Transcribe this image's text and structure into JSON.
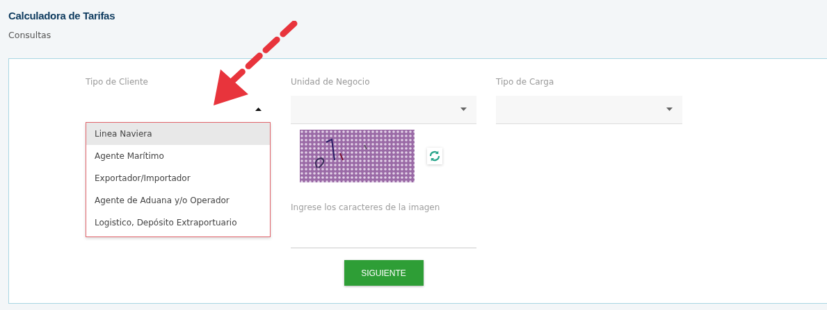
{
  "header": {
    "title": "Calculadora de Tarifas",
    "subtitle": "Consultas"
  },
  "fields": [
    {
      "label": "Tipo de Cliente",
      "kind": "select",
      "expanded": true,
      "options": [
        {
          "label": "Linea Naviera",
          "selected": true
        },
        {
          "label": "Agente Marítimo",
          "selected": false
        },
        {
          "label": "Exportador/Importador",
          "selected": false
        },
        {
          "label": "Agente de Aduana y/o Operador",
          "selected": false
        },
        {
          "label": "Logistico, Depósito Extraportuario",
          "selected": false
        }
      ]
    },
    {
      "label": "Unidad de Negocio",
      "kind": "select",
      "expanded": false
    },
    {
      "label": "Tipo de Carga",
      "kind": "select",
      "expanded": false
    }
  ],
  "captcha": {
    "kind": "picture",
    "label": "Ingrese los caracteres de la imagen"
  },
  "button": "SIGUIENTE"
}
